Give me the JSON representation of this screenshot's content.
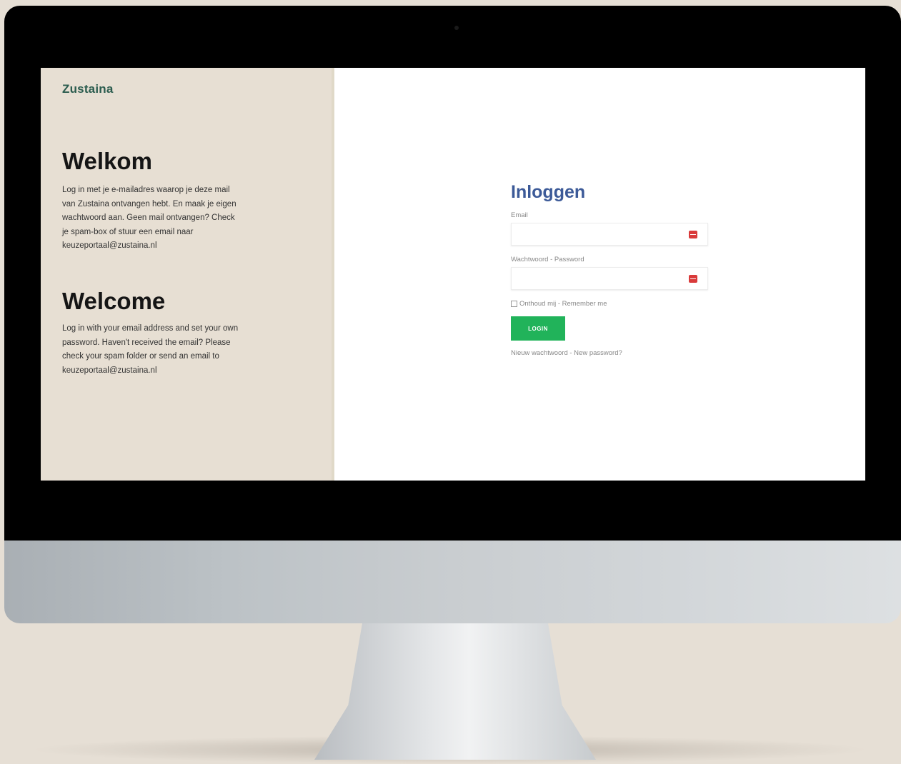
{
  "brand": {
    "logo_text": "Zustaina"
  },
  "welcome_nl": {
    "heading": "Welkom",
    "text": "Log in met je e-mailadres waarop je deze mail van Zustaina ontvangen hebt. En maak je eigen wachtwoord aan. Geen mail ontvangen? Check je spam-box of stuur een email naar keuzeportaal@zustaina.nl"
  },
  "welcome_en": {
    "heading": "Welcome",
    "text": "Log in with your email address and set your own password. Haven't received the email? Please check your spam folder or send an email to keuzeportaal@zustaina.nl"
  },
  "login": {
    "title": "Inloggen",
    "email_label": "Email",
    "email_value": "",
    "password_label": "Wachtwoord - Password",
    "password_value": "",
    "remember_label": "Onthoud mij - Remember me",
    "button_label": "LOGIN",
    "forgot_link": "Nieuw wachtwoord - New password?"
  },
  "colors": {
    "left_panel_bg": "#e7dfd3",
    "logo": "#2b5c4e",
    "title": "#3c5a98",
    "button": "#21b35a",
    "field_icon": "#d93a3a"
  },
  "icons": {
    "email_field_icon": "password-manager-icon",
    "password_field_icon": "password-manager-icon"
  }
}
